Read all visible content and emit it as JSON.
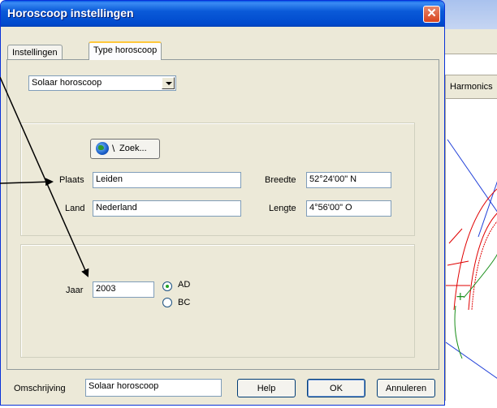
{
  "background_app": {
    "tab_label": "Harmonics"
  },
  "dialog": {
    "title": "Horoscoop instellingen",
    "close_glyph": "✕",
    "tabs": [
      {
        "label": "Instellingen",
        "active": false
      },
      {
        "label": "Type horoscoop",
        "active": true
      }
    ],
    "type_select": {
      "value": "Solaar horoscoop"
    },
    "zoek_button": {
      "label": "Zoek...",
      "icon": "globe-icon",
      "separator": "\\"
    },
    "location": {
      "plaats_label": "Plaats",
      "plaats_value": "Leiden",
      "land_label": "Land",
      "land_value": "Nederland",
      "breedte_label": "Breedte",
      "breedte_value": "52°24'00\" N",
      "lengte_label": "Lengte",
      "lengte_value": "4°56'00\" O"
    },
    "year": {
      "jaar_label": "Jaar",
      "jaar_value": "2003",
      "era_options": [
        {
          "label": "AD",
          "checked": true
        },
        {
          "label": "BC",
          "checked": false
        }
      ]
    },
    "footer": {
      "omschrijving_label": "Omschrijving",
      "omschrijving_value": "Solaar horoscoop",
      "help_label": "Help",
      "ok_label": "OK",
      "annuleren_label": "Annuleren"
    }
  },
  "colors": {
    "titlebar": "#0a5ad8",
    "dialog_face": "#ece9d8",
    "chart_red": "#e00000",
    "chart_blue": "#1f3fd8",
    "chart_green": "#1b8f1b"
  }
}
